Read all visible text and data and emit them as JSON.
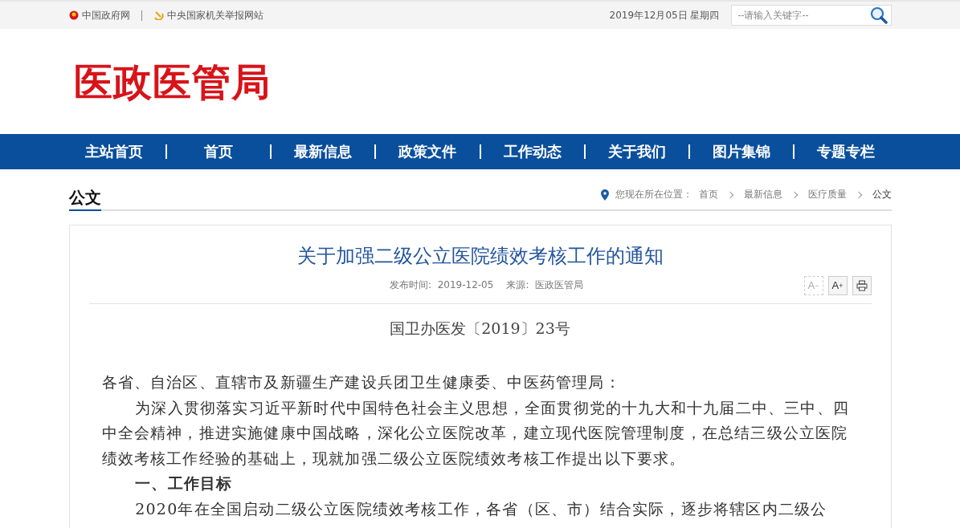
{
  "top_bar": {
    "links": [
      {
        "label": "中国政府网",
        "kind": "emblem"
      },
      {
        "label": "中央国家机关举报网站",
        "kind": "party"
      }
    ],
    "date": "2019年12月05日 星期四",
    "search": {
      "placeholder": "--请输入关键字--"
    }
  },
  "site_title": "医政医管局",
  "nav": [
    "主站首页",
    "首页",
    "最新信息",
    "政策文件",
    "工作动态",
    "关于我们",
    "图片集锦",
    "专题专栏"
  ],
  "section_title": "公文",
  "breadcrumb": {
    "label": "您现在所在位置：",
    "items": [
      "首页",
      "最新信息",
      "医疗质量",
      "公文"
    ]
  },
  "article": {
    "title": "关于加强二级公立医院绩效考核工作的通知",
    "meta": [
      {
        "label": "发布时间:",
        "value": "2019-12-05"
      },
      {
        "label": "来源:",
        "value": "医政医管局"
      }
    ],
    "tools": [
      {
        "kind": "font",
        "label": "A",
        "sup": "−",
        "disabled": true
      },
      {
        "kind": "font",
        "label": "A",
        "sup": "+",
        "disabled": false
      },
      {
        "kind": "print",
        "disabled": false
      }
    ],
    "doc_number": "国卫办医发〔2019〕23号",
    "body": [
      {
        "kind": "salutation",
        "text": "各省、自治区、直辖市及新疆生产建设兵团卫生健康委、中医药管理局："
      },
      {
        "kind": "paragraph",
        "text": "为深入贯彻落实习近平新时代中国特色社会主义思想，全面贯彻党的十九大和十九届二中、三中、四中全会精神，推进实施健康中国战略，深化公立医院改革，建立现代医院管理制度，在总结三级公立医院绩效考核工作经验的基础上，现就加强二级公立医院绩效考核工作提出以下要求。"
      },
      {
        "kind": "heading",
        "text": "一、工作目标"
      },
      {
        "kind": "paragraph",
        "text": "2020年在全国启动二级公立医院绩效考核工作，各省（区、市）结合实际，逐步将辖区内二级公"
      }
    ]
  }
}
